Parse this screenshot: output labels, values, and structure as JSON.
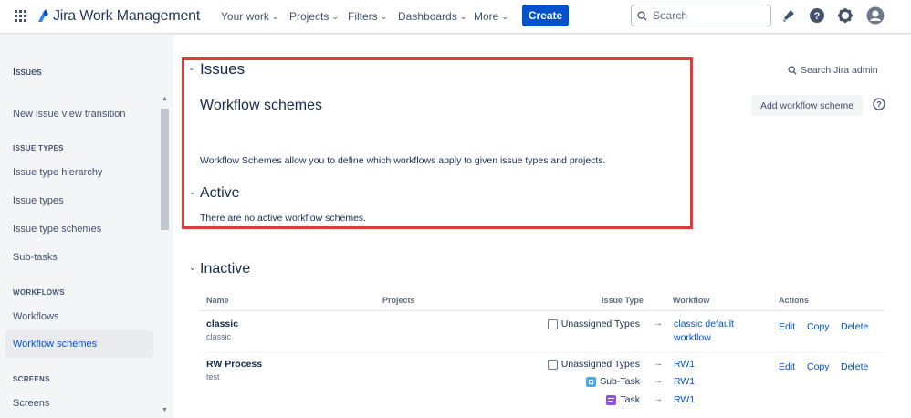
{
  "topnav": {
    "product": "Jira Work Management",
    "items": [
      {
        "label": "Your work",
        "has_chevron": true
      },
      {
        "label": "Projects",
        "has_chevron": true
      },
      {
        "label": "Filters",
        "has_chevron": true
      },
      {
        "label": "Dashboards",
        "has_chevron": true
      },
      {
        "label": "More",
        "has_chevron": true
      }
    ],
    "create_label": "Create",
    "search_placeholder": "Search",
    "icons": [
      "notifications-icon",
      "help-icon",
      "settings-icon",
      "profile-avatar-icon"
    ]
  },
  "sidebar": {
    "title": "Issues",
    "items": {
      "new_issue_view": "New issue view transition",
      "issue_types_head": "ISSUE TYPES",
      "issue_type_hierarchy": "Issue type hierarchy",
      "issue_types": "Issue types",
      "issue_type_schemes": "Issue type schemes",
      "sub_tasks": "Sub-tasks",
      "workflows_head": "WORKFLOWS",
      "workflows": "Workflows",
      "workflow_schemes": "Workflow schemes",
      "screens_head": "SCREENS",
      "screens": "Screens"
    },
    "selected": "Workflow schemes"
  },
  "main": {
    "section_title": "Issues",
    "page_title": "Workflow schemes",
    "search_admin": "Search Jira admin",
    "add_button": "Add workflow scheme",
    "description": "Workflow Schemes allow you to define which workflows apply to given issue types and projects.",
    "active_title": "Active",
    "active_empty": "There are no active workflow schemes.",
    "inactive_title": "Inactive",
    "table": {
      "headers": {
        "name": "Name",
        "projects": "Projects",
        "issue_type": "Issue Type",
        "workflow": "Workflow",
        "actions": "Actions"
      },
      "rows": [
        {
          "name": "classic",
          "description": "classic",
          "mappings": [
            {
              "issue_type": "Unassigned Types",
              "icon": "unassigned-types-icon",
              "workflow": "classic default workflow"
            }
          ],
          "actions": [
            "Edit",
            "Copy",
            "Delete"
          ]
        },
        {
          "name": "RW Process",
          "description": "test",
          "mappings": [
            {
              "issue_type": "Unassigned Types",
              "icon": "unassigned-types-icon",
              "workflow": "RW1"
            },
            {
              "issue_type": "Sub-Task",
              "icon": "subtask-icon",
              "workflow": "RW1"
            },
            {
              "issue_type": "Task",
              "icon": "task-icon",
              "workflow": "RW1"
            }
          ],
          "actions": [
            "Edit",
            "Copy",
            "Delete"
          ]
        }
      ]
    },
    "arrow": "→"
  },
  "colors": {
    "brand": "#0052cc",
    "link": "#0052cc",
    "highlight_border": "#e03b3b",
    "sidebar_bg": "#f4f5f7"
  }
}
